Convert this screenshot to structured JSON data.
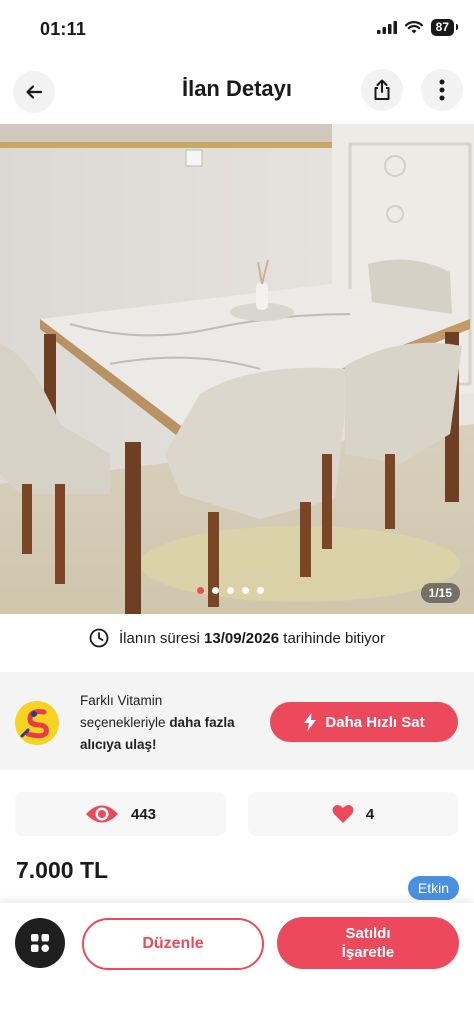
{
  "status_bar": {
    "time": "01:11",
    "battery": "87"
  },
  "header": {
    "title": "İlan Detayı"
  },
  "photo": {
    "counter": "1/15",
    "total_dots": 5,
    "active_dot": 0
  },
  "expiry": {
    "prefix": "İlanın süresi",
    "date": "13/09/2026",
    "suffix": "tarihinde bitiyor"
  },
  "promo": {
    "line1": "Farklı Vitamin",
    "line2_plain": "seçenekleriyle",
    "line2_bold": "daha fazla",
    "line3_bold": "alıcıya ulaş!",
    "button": "Daha Hızlı Sat"
  },
  "stats": {
    "views": "443",
    "favorites": "4"
  },
  "listing": {
    "price": "7.000 TL",
    "status": "Etkin"
  },
  "bottom": {
    "edit_label": "Düzenle",
    "sold_line1": "Satıldı",
    "sold_line2": "İşaretle"
  },
  "colors": {
    "accent": "#ec4a5c",
    "badge_blue": "#4a8fe0"
  }
}
